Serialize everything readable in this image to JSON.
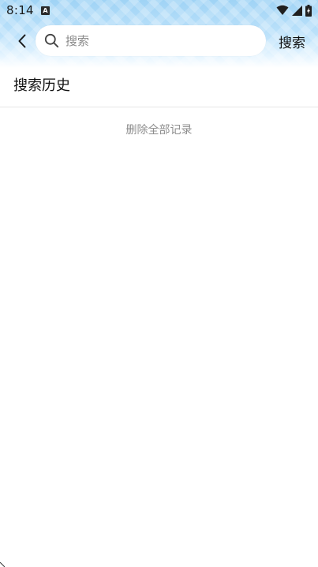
{
  "status_bar": {
    "time": "8:14",
    "notification_icon": "a-letter-icon",
    "icons": [
      "wifi-icon",
      "cellular-signal-icon",
      "battery-charging-icon"
    ]
  },
  "nav": {
    "back_icon": "chevron-left-icon",
    "search_placeholder": "搜索",
    "search_value": "",
    "search_button_label": "搜索"
  },
  "history": {
    "title": "搜索历史",
    "items": [],
    "clear_all_label": "删除全部记录"
  },
  "colors": {
    "header_top": "#9fd3f5",
    "header_bottom": "#ffffff",
    "muted_text": "#8e8e8e",
    "divider": "#e6e6e6"
  }
}
